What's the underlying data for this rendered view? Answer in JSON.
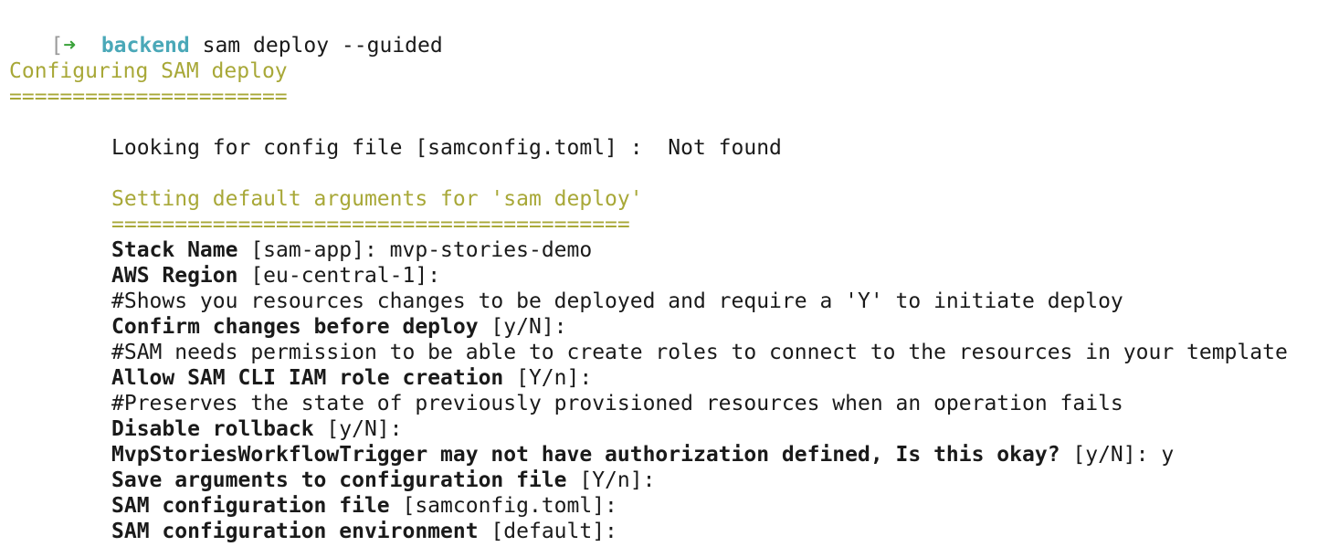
{
  "terminal": {
    "prompt": {
      "bracket": "[",
      "arrow": "➜",
      "directory": "backend",
      "command": "sam deploy --guided"
    },
    "header": {
      "title": "Configuring SAM deploy",
      "underline": "======================"
    },
    "config_lookup": "Looking for config file [samconfig.toml] :  Not found",
    "defaults_section": {
      "title": "Setting default arguments for 'sam deploy'",
      "underline": "========================================="
    },
    "prompts": [
      {
        "label": "Stack Name",
        "rest": " [sam-app]: mvp-stories-demo"
      },
      {
        "label": "AWS Region",
        "rest": " [eu-central-1]:"
      },
      {
        "comment": "#Shows you resources changes to be deployed and require a 'Y' to initiate deploy"
      },
      {
        "label": "Confirm changes before deploy",
        "rest": " [y/N]:"
      },
      {
        "comment": "#SAM needs permission to be able to create roles to connect to the resources in your template"
      },
      {
        "label": "Allow SAM CLI IAM role creation",
        "rest": " [Y/n]:"
      },
      {
        "comment": "#Preserves the state of previously provisioned resources when an operation fails"
      },
      {
        "label": "Disable rollback",
        "rest": " [y/N]:"
      },
      {
        "label": "MvpStoriesWorkflowTrigger may not have authorization defined, Is this okay?",
        "rest": " [y/N]: y"
      },
      {
        "label": "Save arguments to configuration file",
        "rest": " [Y/n]:"
      },
      {
        "label": "SAM configuration file",
        "rest": " [samconfig.toml]:"
      },
      {
        "label": "SAM configuration environment",
        "rest": " [default]:"
      }
    ],
    "colors": {
      "prompt_arrow": "#3aa23a",
      "prompt_directory": "#4aa8b8",
      "section_heading": "#a8a838",
      "text": "#1a1a1a"
    }
  }
}
